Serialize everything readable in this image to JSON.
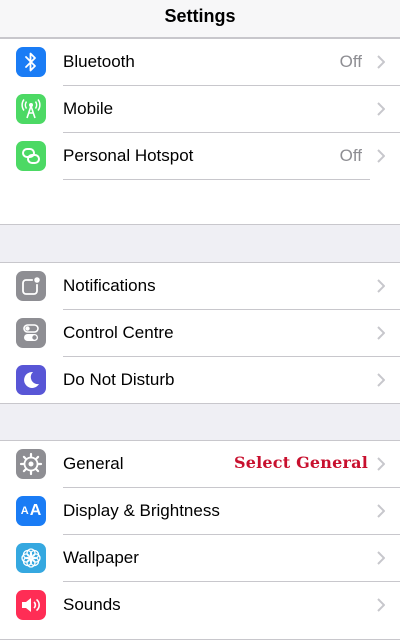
{
  "header": {
    "title": "Settings"
  },
  "group1": [
    {
      "label": "Bluetooth",
      "value": "Off",
      "icon": "bluetooth-icon",
      "color": "#1a7cf5"
    },
    {
      "label": "Mobile",
      "value": "",
      "icon": "antenna-icon",
      "color": "#4cd964"
    },
    {
      "label": "Personal Hotspot",
      "value": "Off",
      "icon": "hotspot-icon",
      "color": "#4cd964"
    }
  ],
  "group2": [
    {
      "label": "Notifications",
      "icon": "notifications-icon",
      "color": "#8e8e93"
    },
    {
      "label": "Control Centre",
      "icon": "control-centre-icon",
      "color": "#8e8e93"
    },
    {
      "label": "Do Not Disturb",
      "icon": "moon-icon",
      "color": "#5856d6"
    }
  ],
  "group3": [
    {
      "label": "General",
      "icon": "gear-icon",
      "color": "#8e8e93"
    },
    {
      "label": "Display & Brightness",
      "icon": "text-size-icon",
      "color": "#1a7cf5"
    },
    {
      "label": "Wallpaper",
      "icon": "flower-icon",
      "color": "#35a8e0"
    },
    {
      "label": "Sounds",
      "icon": "speaker-icon",
      "color": "#ff2d55"
    }
  ],
  "annotation": "Select General"
}
